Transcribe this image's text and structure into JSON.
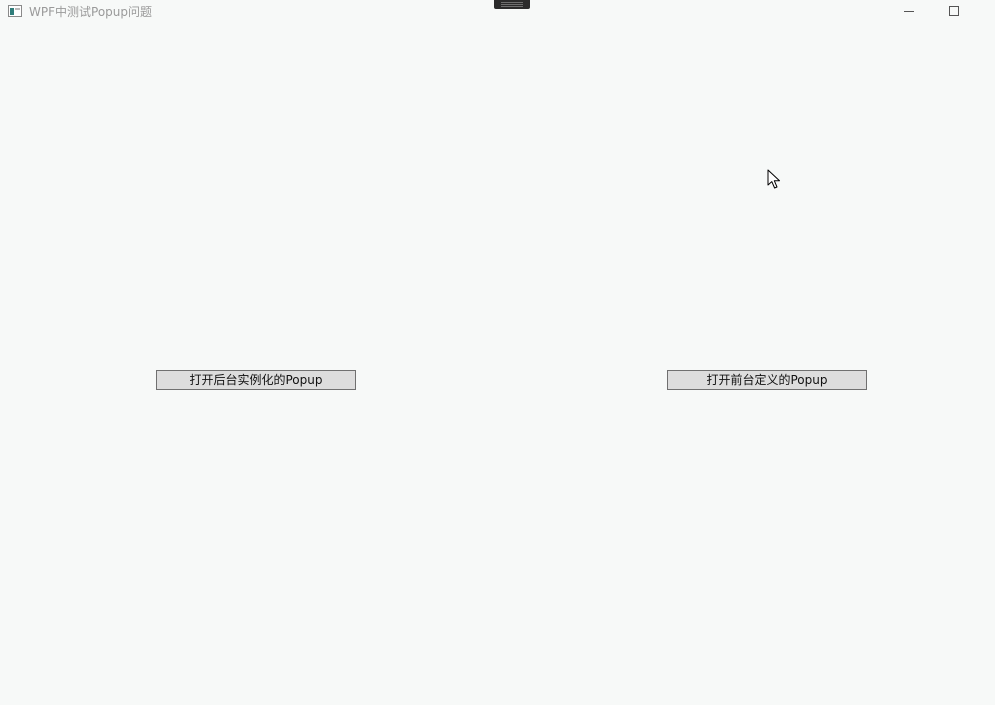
{
  "window": {
    "title": "WPF中测试Popup问题",
    "icon": "window-app-icon"
  },
  "titlebar_controls": {
    "minimize_icon": "minimize-icon",
    "maximize_icon": "maximize-icon"
  },
  "buttons": {
    "open_code_popup_label": "打开后台实例化的Popup",
    "open_xaml_popup_label": "打开前台定义的Popup"
  },
  "colors": {
    "background": "#f7f9f8",
    "button_face": "#dddddd",
    "button_border": "#707070",
    "title_text": "#9a9a9a"
  }
}
